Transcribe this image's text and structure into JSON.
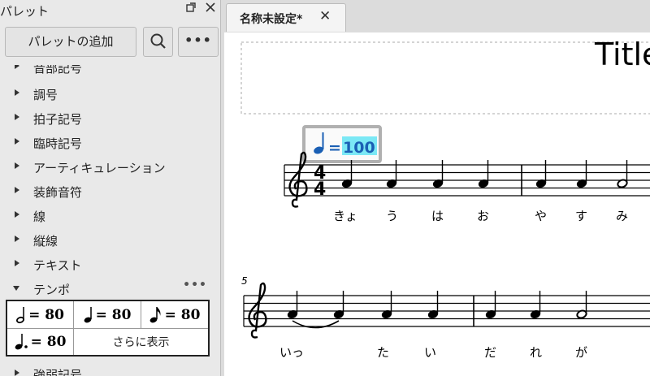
{
  "palette": {
    "title": "パレット",
    "add_label": "パレットの追加",
    "more_label": "•••",
    "partial_top": "音部記号",
    "categories": [
      {
        "label": "調号"
      },
      {
        "label": "拍子記号"
      },
      {
        "label": "臨時記号"
      },
      {
        "label": "アーティキュレーション"
      },
      {
        "label": "装飾音符"
      },
      {
        "label": "線"
      },
      {
        "label": "縦線"
      },
      {
        "label": "テキスト"
      }
    ],
    "tempo_label": "テンポ",
    "tempo_more": "•••",
    "tempo_cells": [
      {
        "label": "= 80",
        "note": "half"
      },
      {
        "label": "= 80",
        "note": "quarter"
      },
      {
        "label": "= 80",
        "note": "eighth"
      },
      {
        "label": "= 80",
        "note": "dotted-quarter"
      }
    ],
    "show_more": "さらに表示",
    "partial_bottom": "強弱記号"
  },
  "tab": {
    "label": "名称未設定*"
  },
  "score": {
    "title": "Title",
    "tempo_marking": {
      "eq": "=",
      "value": "100"
    },
    "measure_number": "5",
    "time_signature": {
      "top": "4",
      "bottom": "4"
    },
    "lyrics_row1": [
      "きょ",
      "う",
      "は",
      "お",
      "や",
      "す",
      "み"
    ],
    "lyrics_row2": [
      "いっ",
      "た",
      "い",
      "だ",
      "れ",
      "が"
    ]
  },
  "colors": {
    "tempo_blue": "#1a5fb4",
    "highlight": "#7be8f5"
  }
}
